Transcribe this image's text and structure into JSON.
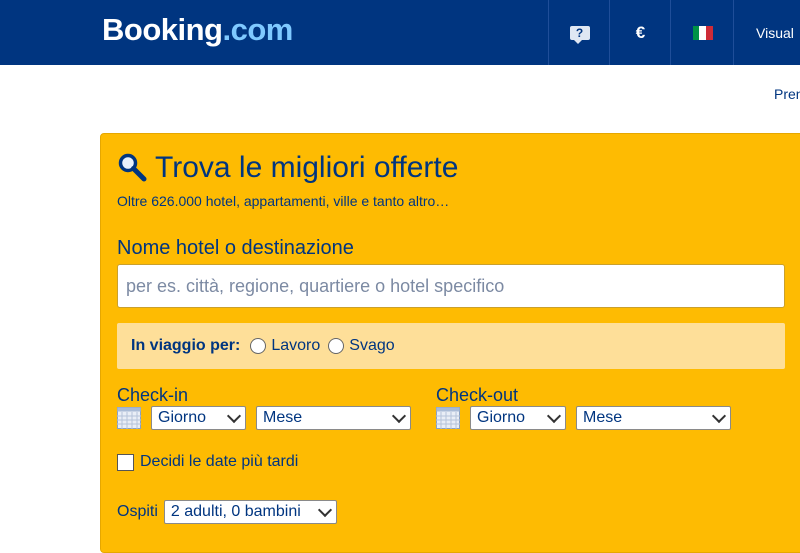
{
  "header": {
    "logo_main": "Booking",
    "logo_suffix": ".com",
    "help_glyph": "?",
    "currency": "€",
    "language_flag": "italy-flag-icon",
    "account_label": "Visual"
  },
  "top_link": "Pren",
  "search": {
    "title": "Trova le migliori offerte",
    "subtitle": "Oltre 626.000 hotel, appartamenti, ville e tanto altro…",
    "destination_label": "Nome hotel o destinazione",
    "destination_placeholder": "per es. città, regione, quartiere o hotel specifico",
    "destination_value": "",
    "travel_purpose": {
      "label": "In viaggio per:",
      "options": [
        "Lavoro",
        "Svago"
      ]
    },
    "checkin": {
      "label": "Check-in",
      "day": "Giorno",
      "month": "Mese"
    },
    "checkout": {
      "label": "Check-out",
      "day": "Giorno",
      "month": "Mese"
    },
    "decide_later": "Decidi le date più tardi",
    "guests": {
      "label": "Ospiti",
      "value": "2 adulti, 0 bambini"
    }
  },
  "colors": {
    "header_bg": "#003580",
    "search_bg": "#febb02",
    "travel_bg": "#fedf99",
    "text": "#003580"
  }
}
